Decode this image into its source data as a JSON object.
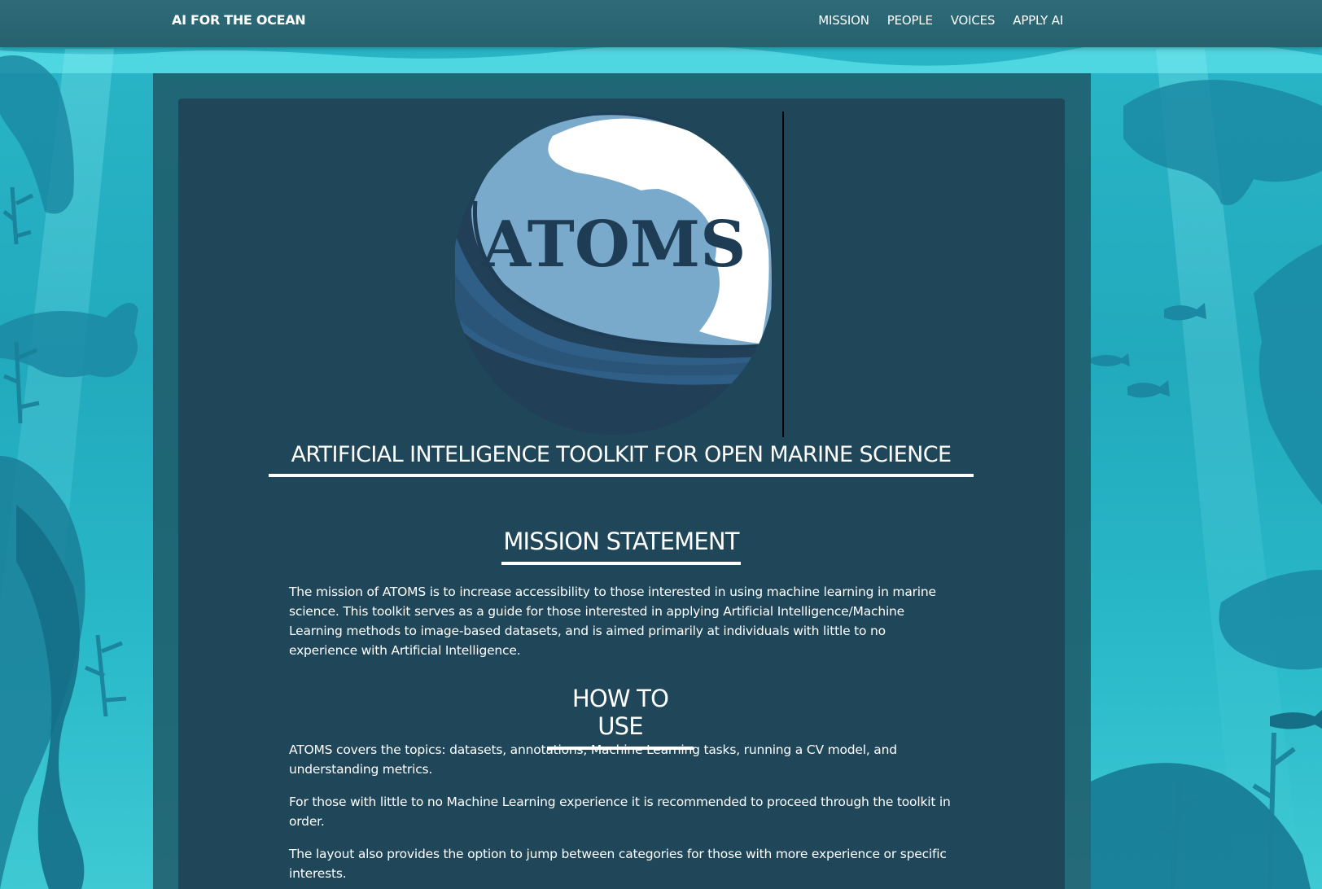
{
  "navbar": {
    "brand": "AI FOR THE OCEAN",
    "links": [
      "MISSION",
      "PEOPLE",
      "VOICES",
      "APPLY AI"
    ]
  },
  "logo": {
    "text": "ATOMS",
    "icon": "wave-globe-logo"
  },
  "main": {
    "title": "ARTIFICIAL INTELIGENCE TOOLKIT FOR OPEN MARINE SCIENCE",
    "mission": {
      "heading": "MISSION STATEMENT",
      "text": "The mission of ATOMS is to increase accessibility to those interested in using machine learning in marine science. This toolkit serves as a guide for those interested in applying Artificial Intelligence/Machine Learning methods to image-based datasets, and is aimed primarily at individuals with little to no experience with Artificial Intelligence."
    },
    "how_to_use": {
      "heading": "HOW TO USE",
      "paragraphs": [
        "ATOMS covers the topics: datasets, annotations, Machine Learning tasks, running a CV model, and understanding metrics.",
        "For those with little to no Machine Learning experience it is recommended to proceed through the toolkit in order.",
        "The layout also provides the option to jump between categories for those with more experience or specific interests."
      ]
    }
  },
  "colors": {
    "navbar": "#2b6673",
    "panel": "#1f4659",
    "ocean": "#2ab7c8",
    "silhouette": "#1a8aa3"
  }
}
